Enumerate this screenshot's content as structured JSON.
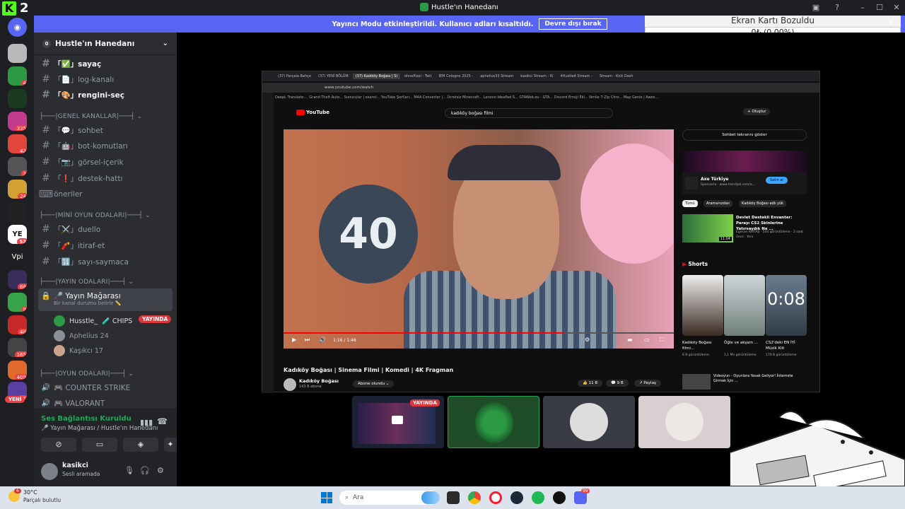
{
  "titlebar": {
    "app_count": "2",
    "window_title": "Hustle'ın Hanedanı"
  },
  "notice": {
    "text": "Yayıncı Modu etkinleştirildi. Kullanıcı adları kısaltıldı.",
    "button": "Devre dışı bırak"
  },
  "overlay": {
    "title": "Ekran Kartı Bozuldu",
    "value": "0₺ (0.00%)"
  },
  "guilds": [
    {
      "badge": ""
    },
    {
      "badge": "4"
    },
    {
      "badge": ""
    },
    {
      "badge": "335"
    },
    {
      "badge": "42"
    },
    {
      "badge": "3"
    },
    {
      "badge": "24"
    },
    {
      "badge": ""
    },
    {
      "badge": "53"
    },
    {
      "badge": ""
    },
    {
      "badge": "66"
    },
    {
      "badge": "9"
    },
    {
      "badge": "48"
    },
    {
      "badge": "165"
    },
    {
      "badge": "409"
    },
    {
      "badge": "11"
    }
  ],
  "guild_vpi_label": "Vpi",
  "guild_new_label": "YENİ",
  "server": {
    "name": "Hustle'ın Hanedanı",
    "members_icon": "0"
  },
  "channels": {
    "top": [
      {
        "label": "「✅」sayaç",
        "bold": true
      },
      {
        "label": "「📄」log-kanalı",
        "bold": false
      },
      {
        "label": "「🎨」rengini-seç",
        "bold": true
      }
    ],
    "cat_general": "├───|GENEL KANALLAR|───┤ ⌄",
    "general": [
      {
        "label": "「💬」sohbet"
      },
      {
        "label": "「🤖」bot-komutları"
      },
      {
        "label": "「📷」görsel-içerik"
      },
      {
        "label": "「❗」destek-hattı"
      },
      {
        "label": "öneriler"
      }
    ],
    "cat_mini": "├───|MİNİ OYUN ODALARI|───┤ ⌄",
    "mini": [
      {
        "label": "「⚔️」duello"
      },
      {
        "label": "「🧨」itiraf-et"
      },
      {
        "label": "「🔢」sayı-saymaca"
      }
    ],
    "cat_stream": "├───|YAYIN ODALARI|───┤ ⌄",
    "stream_channel": {
      "label": "🎤 Yayın Mağarası",
      "status": "Bir kanal durumu belirle ✏️"
    },
    "voice_users": [
      {
        "name": "Husstle_",
        "tag": "🧪 CHIPS",
        "live": "YAYINDA"
      },
      {
        "name": "Aphelius 24"
      },
      {
        "name": "Kaşıkcı 17"
      }
    ],
    "cat_games": "├───|OYUN ODALARI|───┤ ⌄",
    "games": [
      {
        "label": "🎮 COUNTER STRIKE"
      },
      {
        "label": "🎮 VALORANT"
      }
    ]
  },
  "voice": {
    "status": "Ses Bağlantısı Kuruldu",
    "location": "🎤 Yayın Mağarası / Hustle'ın Hanedanı"
  },
  "user": {
    "name": "kasikci",
    "status": "Sesli aramada"
  },
  "browser": {
    "tabs": [
      "(37) Parçala Behçe",
      "(37) YENİ BÖLÜM",
      "(37) Kadıköy Boğası | Si",
      "ohnePixel - Twit",
      "IEM Cologne 2025 -",
      "aphelius33 Stream",
      "kasikci Stream - Ki",
      "4Hustle4 Stream -",
      "Stream - Kick Dash"
    ],
    "url": "www.youtube.com/watch",
    "bookmarks": "DeepL Translate:...   Grand Theft Auto...   Sunucular | exarot...   YouTube Şortları...   M4A Converter |...   Ücretsiz Minecraft...   Lenovo IdeaPad S...   GTAWeb.eu - GTA...   Discord Emoji Ekl...   Nmile 7-Zip Chro...   Map Genie | Awes..."
  },
  "youtube": {
    "logo": "YouTube",
    "search": "kadıköy boğası filmi",
    "create": "+ Oluştur",
    "sign_number": "40",
    "time": "1:16 / 1:46",
    "progress": 0.72,
    "title": "Kadıköy Boğası | Sinema Filmi | Komedi | 4K Fragman",
    "channel": "Kadıköy Boğası",
    "subs": "143 B abone",
    "subscribed": "Abone olundu ⌄",
    "likes": "👍 11 B",
    "comments": "💬 9 B",
    "share": "↗ Paylaş",
    "show_chat": "Sohbet tekrarını göster",
    "ad_title": "Axe Türkiye",
    "ad_sub": "Sponsorlu · www.trendyol.com/a...",
    "ad_btn": "Satın al",
    "chips": [
      "Tümü",
      "Aramanızdan",
      "Kadıköy Boğası adlı yük"
    ],
    "rec_title": "Devlet Destekli Envanter: Parayı CS2 Skinlerine Yatırsaydık Ne ...",
    "rec_meta": "Egecan KIRTAŞ · 544 görüntüleme · 2 saat önce · Yeni",
    "rec_duration": "11:04",
    "shorts_label": "Shorts",
    "shorts": [
      {
        "title": "Kadıköy Boğası filmi...",
        "meta": "6 B görüntüleme"
      },
      {
        "title": "Öğle ve akşam ...",
        "meta": "1,1 Mn görüntüleme"
      },
      {
        "title": "CS2'deki EN İYİ Müzik Kiti",
        "meta": "170 B görüntüleme"
      }
    ],
    "shorts_overlay": "0:08",
    "more_rec": "Videoyun - Oyunlara Yasak Geliyor! İnternete Girmek İçin ..."
  },
  "tiles": [
    {
      "live": "YAYINDA"
    },
    {},
    {},
    {}
  ],
  "taskbar": {
    "temp": "30°C",
    "weather": "Parçalı bulutlu",
    "weather_badge": "6",
    "search": "Ara",
    "discord_badge": "99"
  }
}
